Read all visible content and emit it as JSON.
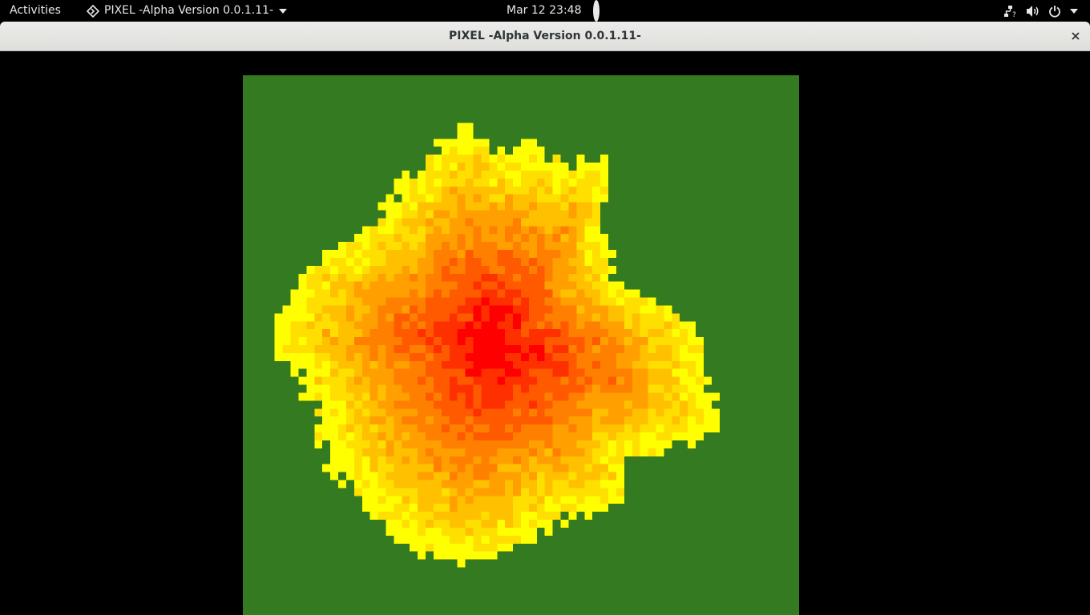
{
  "topbar": {
    "activities_label": "Activities",
    "app_name": "PIXEL -Alpha Version 0.0.1.11-",
    "clock": "Mar 12  23:48",
    "icons": [
      "network-icon",
      "volume-icon",
      "power-icon",
      "chevron-down-icon"
    ]
  },
  "window": {
    "title": "PIXEL -Alpha Version 0.0.1.11-",
    "close_glyph": "×"
  },
  "game": {
    "grid": {
      "cell": 10,
      "cols": 70,
      "rows": 68
    },
    "palette": {
      "background": "#337a20",
      "levels": [
        "#ffff00",
        "#ffdf00",
        "#ffc000",
        "#ff9f00",
        "#ff7f00",
        "#ff5a00",
        "#ff3000",
        "#ff0000"
      ]
    },
    "blob": {
      "center": [
        32,
        34
      ],
      "rays": [
        {
          "deg": 0,
          "r": 26
        },
        {
          "deg": 10,
          "r": 23
        },
        {
          "deg": 20,
          "r": 18
        },
        {
          "deg": 30,
          "r": 17
        },
        {
          "deg": 40,
          "r": 18
        },
        {
          "deg": 50,
          "r": 20
        },
        {
          "deg": 60,
          "r": 27
        },
        {
          "deg": 70,
          "r": 24
        },
        {
          "deg": 80,
          "r": 26
        },
        {
          "deg": 90,
          "r": 24
        },
        {
          "deg": 100,
          "r": 28
        },
        {
          "deg": 110,
          "r": 25
        },
        {
          "deg": 120,
          "r": 24
        },
        {
          "deg": 130,
          "r": 22
        },
        {
          "deg": 140,
          "r": 22
        },
        {
          "deg": 150,
          "r": 24
        },
        {
          "deg": 160,
          "r": 27
        },
        {
          "deg": 170,
          "r": 27
        },
        {
          "deg": 180,
          "r": 28
        },
        {
          "deg": 190,
          "r": 25
        },
        {
          "deg": 200,
          "r": 24
        },
        {
          "deg": 210,
          "r": 25
        },
        {
          "deg": 220,
          "r": 26
        },
        {
          "deg": 230,
          "r": 26
        },
        {
          "deg": 240,
          "r": 27
        },
        {
          "deg": 250,
          "r": 28
        },
        {
          "deg": 260,
          "r": 28
        },
        {
          "deg": 270,
          "r": 27
        },
        {
          "deg": 280,
          "r": 25
        },
        {
          "deg": 290,
          "r": 23
        },
        {
          "deg": 300,
          "r": 25
        },
        {
          "deg": 310,
          "r": 24
        },
        {
          "deg": 320,
          "r": 22
        },
        {
          "deg": 330,
          "r": 25
        },
        {
          "deg": 340,
          "r": 30
        },
        {
          "deg": 350,
          "r": 27
        }
      ]
    }
  }
}
